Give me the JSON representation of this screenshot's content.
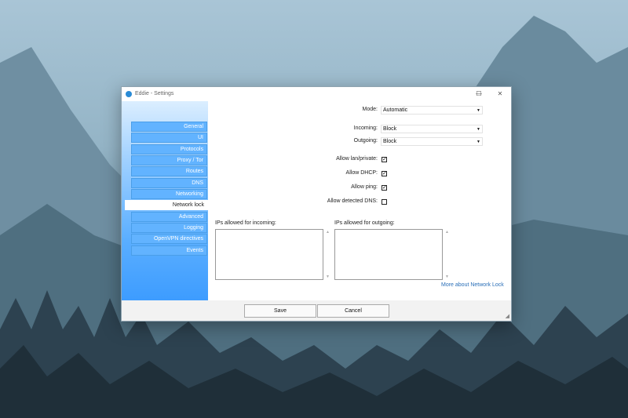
{
  "window": {
    "title": "Eddie - Settings",
    "controls": {
      "minimize": "—",
      "maximize": "☐",
      "close": "✕"
    }
  },
  "sidebar": {
    "items": [
      {
        "label": "General"
      },
      {
        "label": "UI"
      },
      {
        "label": "Protocols"
      },
      {
        "label": "Proxy / Tor"
      },
      {
        "label": "Routes"
      },
      {
        "label": "DNS"
      },
      {
        "label": "Networking"
      },
      {
        "label": "Network lock",
        "active": true
      },
      {
        "label": "Advanced"
      },
      {
        "label": "Logging"
      },
      {
        "label": "OpenVPN directives"
      },
      {
        "label": "Events"
      }
    ]
  },
  "form": {
    "mode": {
      "label": "Mode:",
      "value": "Automatic"
    },
    "incoming": {
      "label": "Incoming:",
      "value": "Block"
    },
    "outgoing": {
      "label": "Outgoing:",
      "value": "Block"
    },
    "allow_lan": {
      "label": "Allow lan/private:",
      "checked": true
    },
    "allow_dhcp": {
      "label": "Allow DHCP:",
      "checked": true
    },
    "allow_ping": {
      "label": "Allow ping:",
      "checked": true
    },
    "allow_dns": {
      "label": "Allow detected DNS:",
      "checked": false
    },
    "ips_incoming": {
      "label": "IPs allowed for incoming:",
      "value": ""
    },
    "ips_outgoing": {
      "label": "IPs allowed for outgoing:",
      "value": ""
    },
    "more_link": "More about Network Lock"
  },
  "footer": {
    "save": "Save",
    "cancel": "Cancel"
  },
  "colors": {
    "sidebar_top": "#dbeeff",
    "sidebar_bottom": "#3d9cff",
    "link": "#2a6fb8"
  },
  "glyphs": {
    "check": "✓",
    "arrow_down": "▼",
    "arrow_up": "▲",
    "grip": "◢"
  }
}
